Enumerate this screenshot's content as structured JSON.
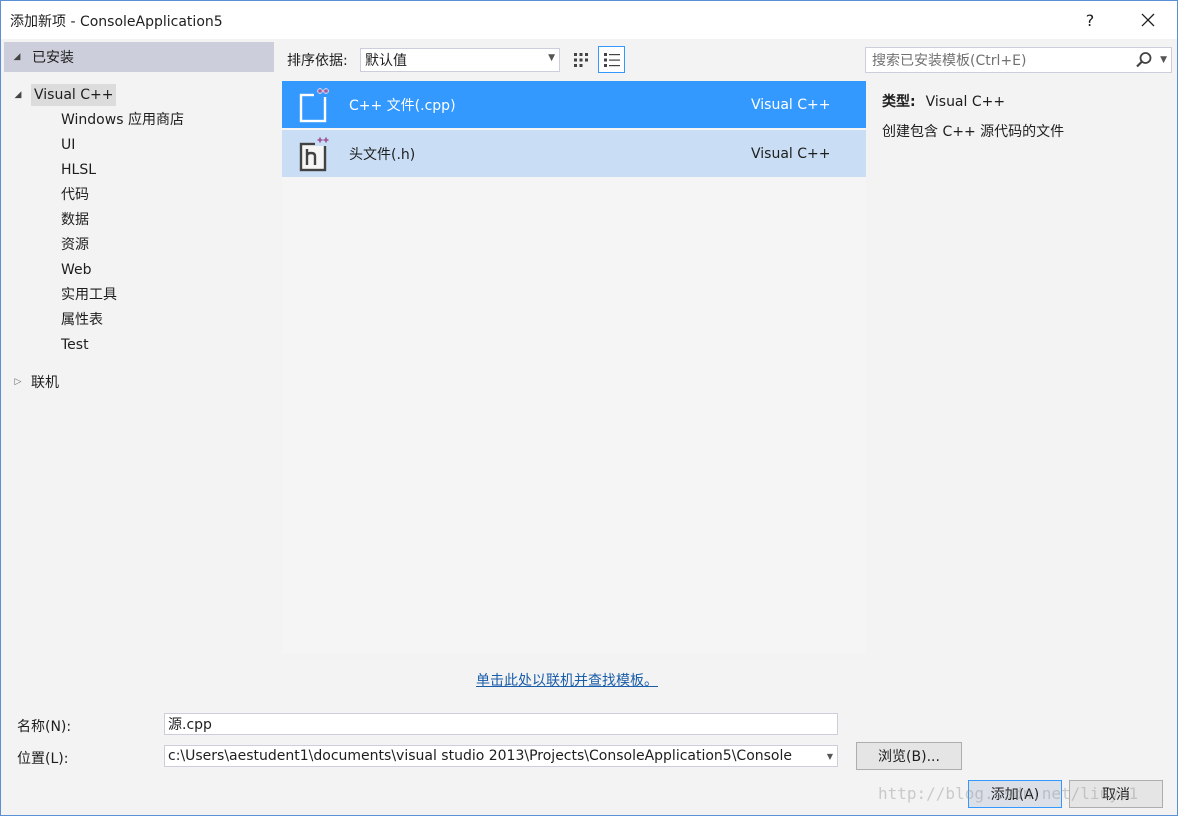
{
  "window": {
    "title": "添加新项 - ConsoleApplication5",
    "help": "?",
    "close": "✕"
  },
  "tree": {
    "installed": "已安装",
    "visual_cpp": "Visual C++",
    "children": [
      "Windows 应用商店",
      "UI",
      "HLSL",
      "代码",
      "数据",
      "资源",
      "Web",
      "实用工具",
      "属性表",
      "Test"
    ],
    "online": "联机"
  },
  "toolbar": {
    "sort_label": "排序依据:",
    "sort_value": "默认值",
    "search_placeholder": "搜索已安装模板(Ctrl+E)"
  },
  "templates": [
    {
      "name": "C++ 文件(.cpp)",
      "language": "Visual C++",
      "icon": "cpp-file-icon",
      "state": "selected"
    },
    {
      "name": "头文件(.h)",
      "language": "Visual C++",
      "icon": "header-file-icon",
      "state": "hover"
    }
  ],
  "details": {
    "type_label": "类型:",
    "type_value": "Visual C++",
    "description": "创建包含 C++ 源代码的文件"
  },
  "online_link": "单击此处以联机并查找模板。",
  "form": {
    "name_label": "名称(N):",
    "name_value": "源.cpp",
    "location_label": "位置(L):",
    "location_value": "c:\\Users\\aestudent1\\documents\\visual studio 2013\\Projects\\ConsoleApplication5\\Console"
  },
  "buttons": {
    "browse": "浏览(B)...",
    "add": "添加(A)",
    "cancel": "取消"
  },
  "watermark": "http://blog.csdn.net/liuyu1"
}
